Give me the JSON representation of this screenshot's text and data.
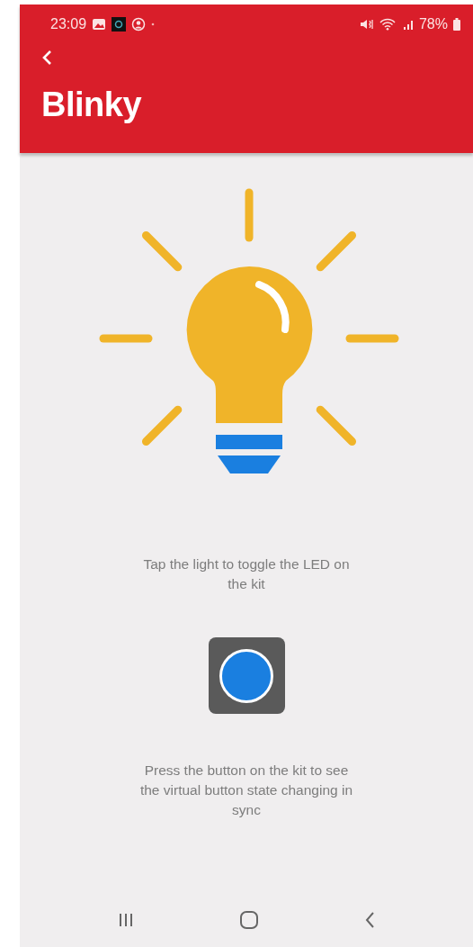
{
  "status_bar": {
    "time": "23:09",
    "battery": "78%"
  },
  "app_bar": {
    "title": "Blinky"
  },
  "light": {
    "on": true
  },
  "light_hint": "Tap the light to toggle the LED on the kit",
  "button_hint": "Press the button on the kit to see the virtual button state changing in sync"
}
